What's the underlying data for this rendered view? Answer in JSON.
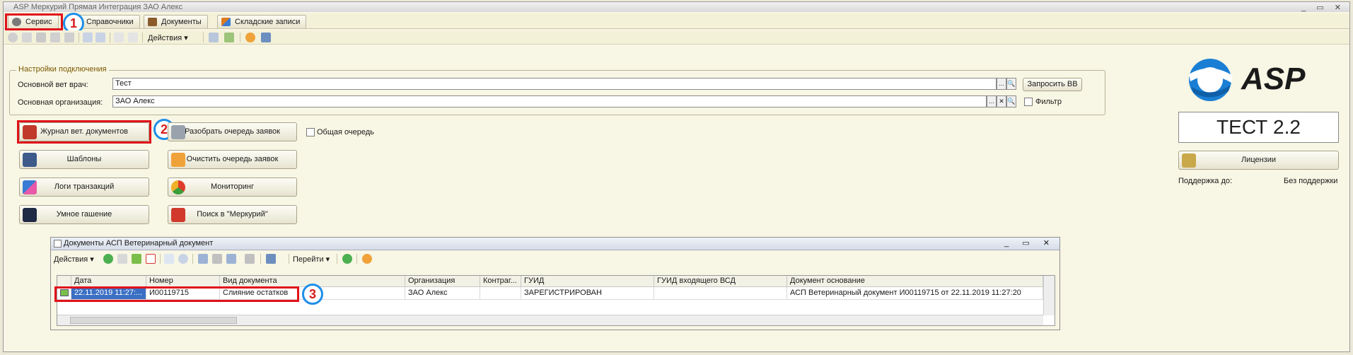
{
  "window": {
    "title": "ASP Меркурий Прямая Интеграция ЗАО Алекс",
    "controls": "_ ▭ ✕"
  },
  "tabs": [
    {
      "label": "Сервис",
      "color": "#7a7a7a"
    },
    {
      "label": "Справочники",
      "color": "#6b8fd6"
    },
    {
      "label": "Документы",
      "color": "#8b5a2b"
    },
    {
      "label": "Складские записи",
      "color": "#e07a1f"
    }
  ],
  "toolbar": {
    "actions_label": "Действия ▾"
  },
  "connection": {
    "group_title": "Настройки подключения",
    "vet_label": "Основной вет врач:",
    "vet_value": "Тест",
    "org_label": "Основная организация:",
    "org_value": "ЗАО Алекс",
    "request_button": "Запросить ВВ",
    "filter_label": "Фильтр",
    "btn_dots": "...",
    "btn_search": "🔍",
    "btn_clear": "✕"
  },
  "buttons": {
    "journal": "Журнал вет. документов",
    "parse_queue": "Разобрать очередь заявок",
    "common_queue": "Общая очередь",
    "templates": "Шаблоны",
    "clear_queue": "Очистить очередь заявок",
    "logs": "Логи транзакций",
    "monitoring": "Мониторинг",
    "smart": "Умное гашение",
    "search_merc": "Поиск в \"Меркурий\""
  },
  "badges": [
    "1",
    "2",
    "3"
  ],
  "right_panel": {
    "logo_text": "ASP",
    "version": "ТЕСТ 2.2",
    "licenses_button": "Лицензии",
    "support_label": "Поддержка до:",
    "support_value": "Без поддержки"
  },
  "subwindow": {
    "title": "Документы АСП Ветеринарный документ",
    "actions_label": "Действия ▾",
    "goto_label": "Перейти ▾",
    "columns": [
      "Дата",
      "Номер",
      "Вид документа",
      "Организация",
      "Контраг...",
      "ГУИД",
      "ГУИД входящего ВСД",
      "Документ основание"
    ],
    "row": {
      "date": "22.11.2019 11:27:...",
      "number": "И00119715",
      "type": "Слияние остатков",
      "org": "ЗАО Алекс",
      "contractor": "",
      "guid": "ЗАРЕГИСТРИРОВАН",
      "guid_in": "",
      "basis": "АСП Ветеринарный документ И00119715 от 22.11.2019 11:27:20"
    }
  },
  "colors": {
    "accent_red": "#e0121b",
    "badge_blue": "#1e8ee8",
    "logo_blue": "#1a7fd4"
  }
}
